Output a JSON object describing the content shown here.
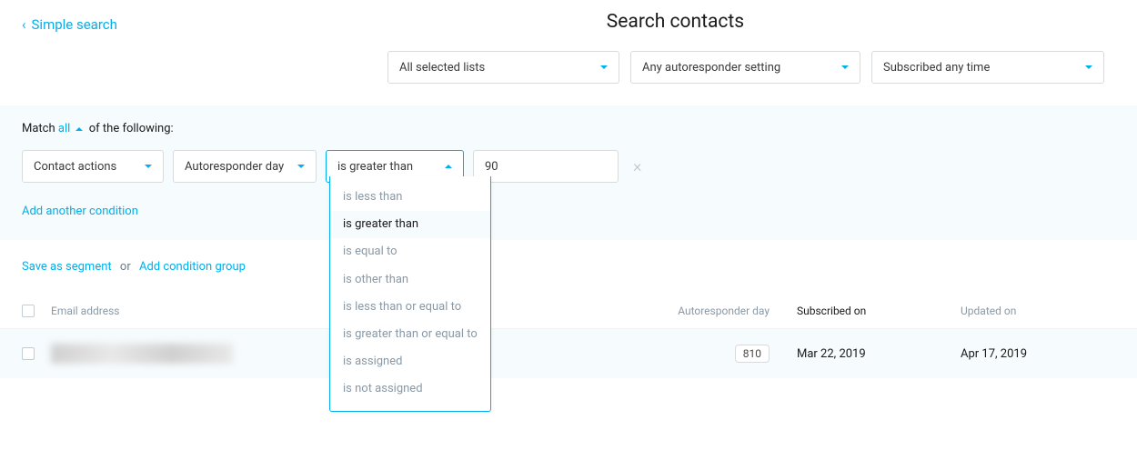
{
  "header": {
    "back_label": "Simple search",
    "title": "Search contacts"
  },
  "filters": {
    "lists": "All selected lists",
    "autoresponder": "Any autoresponder setting",
    "subscribed": "Subscribed any time"
  },
  "match": {
    "prefix": "Match",
    "mode": "all",
    "suffix": "of the following:"
  },
  "condition": {
    "field": "Contact actions",
    "subfield": "Autoresponder day",
    "operator": "is greater than",
    "value": "90"
  },
  "operator_options": [
    "is less than",
    "is greater than",
    "is equal to",
    "is other than",
    "is less than or equal to",
    "is greater than or equal to",
    "is assigned",
    "is not assigned"
  ],
  "links": {
    "add_condition": "Add another condition",
    "save_segment": "Save as segment",
    "or": "or",
    "add_group": "Add condition group"
  },
  "table": {
    "headers": {
      "email": "Email address",
      "ar_day": "Autoresponder day",
      "subscribed": "Subscribed on",
      "updated": "Updated on"
    },
    "rows": [
      {
        "ar_day": "810",
        "subscribed": "Mar 22, 2019",
        "updated": "Apr 17, 2019"
      }
    ]
  }
}
